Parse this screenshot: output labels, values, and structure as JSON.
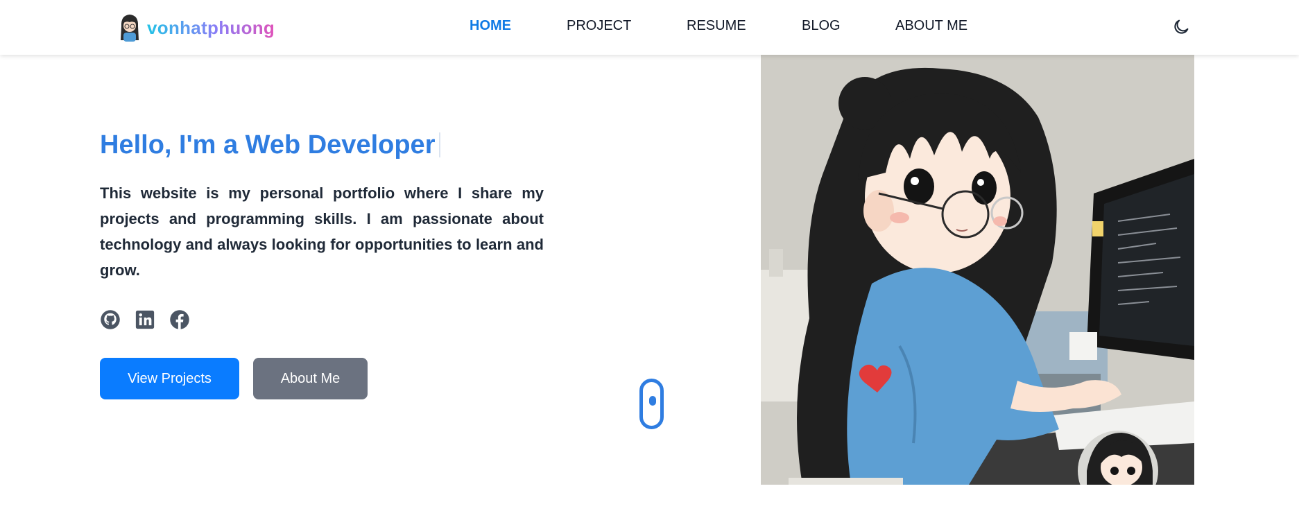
{
  "header": {
    "brand": "vonhatphuong",
    "nav": [
      {
        "label": "HOME",
        "active": true
      },
      {
        "label": "PROJECT",
        "active": false
      },
      {
        "label": "RESUME",
        "active": false
      },
      {
        "label": "BLOG",
        "active": false
      },
      {
        "label": "ABOUT ME",
        "active": false
      }
    ],
    "theme_icon": "moon-icon"
  },
  "hero": {
    "title": "Hello, I'm a Web Developer",
    "description": "This website is my personal portfolio where I share my projects and programming skills. I am passionate about technology and always looking for opportunities to learn and grow.",
    "socials": [
      "github-icon",
      "linkedin-icon",
      "facebook-icon"
    ],
    "primary_button": "View Projects",
    "secondary_button": "About Me",
    "scroll_icon": "mouse-scroll-icon"
  },
  "colors": {
    "accent": "#0f7ae5",
    "title": "#2f7de1",
    "primary_button": "#0a7cff",
    "secondary_button": "#6b7280"
  }
}
